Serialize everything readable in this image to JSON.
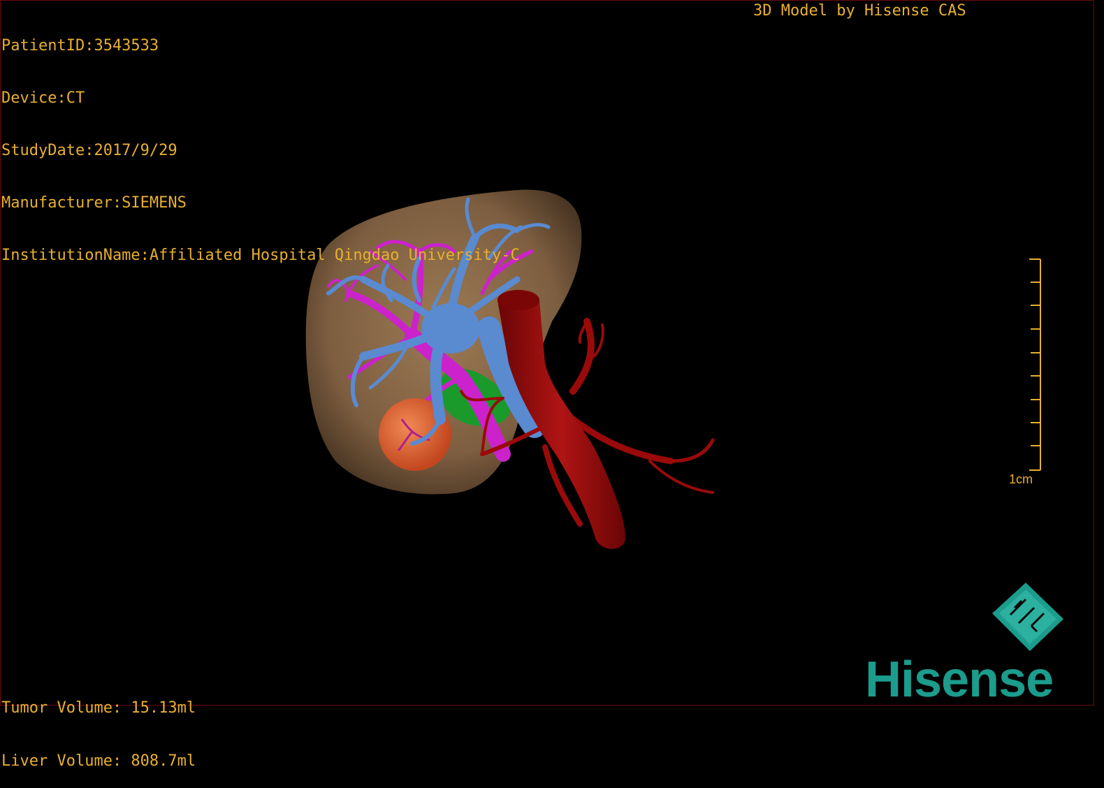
{
  "info": {
    "patient_id": "PatientID:3543533",
    "device": "Device:CT",
    "study_date": "StudyDate:2017/9/29",
    "manufacturer": "Manufacturer:SIEMENS",
    "institution": "InstitutionName:Affiliated Hospital Qingdao University-C"
  },
  "credit": "3D Model by Hisense CAS",
  "volumes": {
    "tumor": "Tumor Volume: 15.13ml",
    "liver": "Liver Volume: 808.7ml"
  },
  "scale_bar": {
    "label": "1cm"
  },
  "brand": {
    "name": "Hisense",
    "logo_icon": "hisense-diamond-logo-icon"
  },
  "colors": {
    "overlay_text": "#e8b030",
    "liver": "#8a6a48",
    "hepatic_vein": "#5a8ad0",
    "portal_vein": "#cc22cc",
    "artery": "#9a0a0a",
    "tumor": "#e0663a",
    "bile_duct": "#1a9a2a",
    "brand": "#1b9c8c"
  }
}
